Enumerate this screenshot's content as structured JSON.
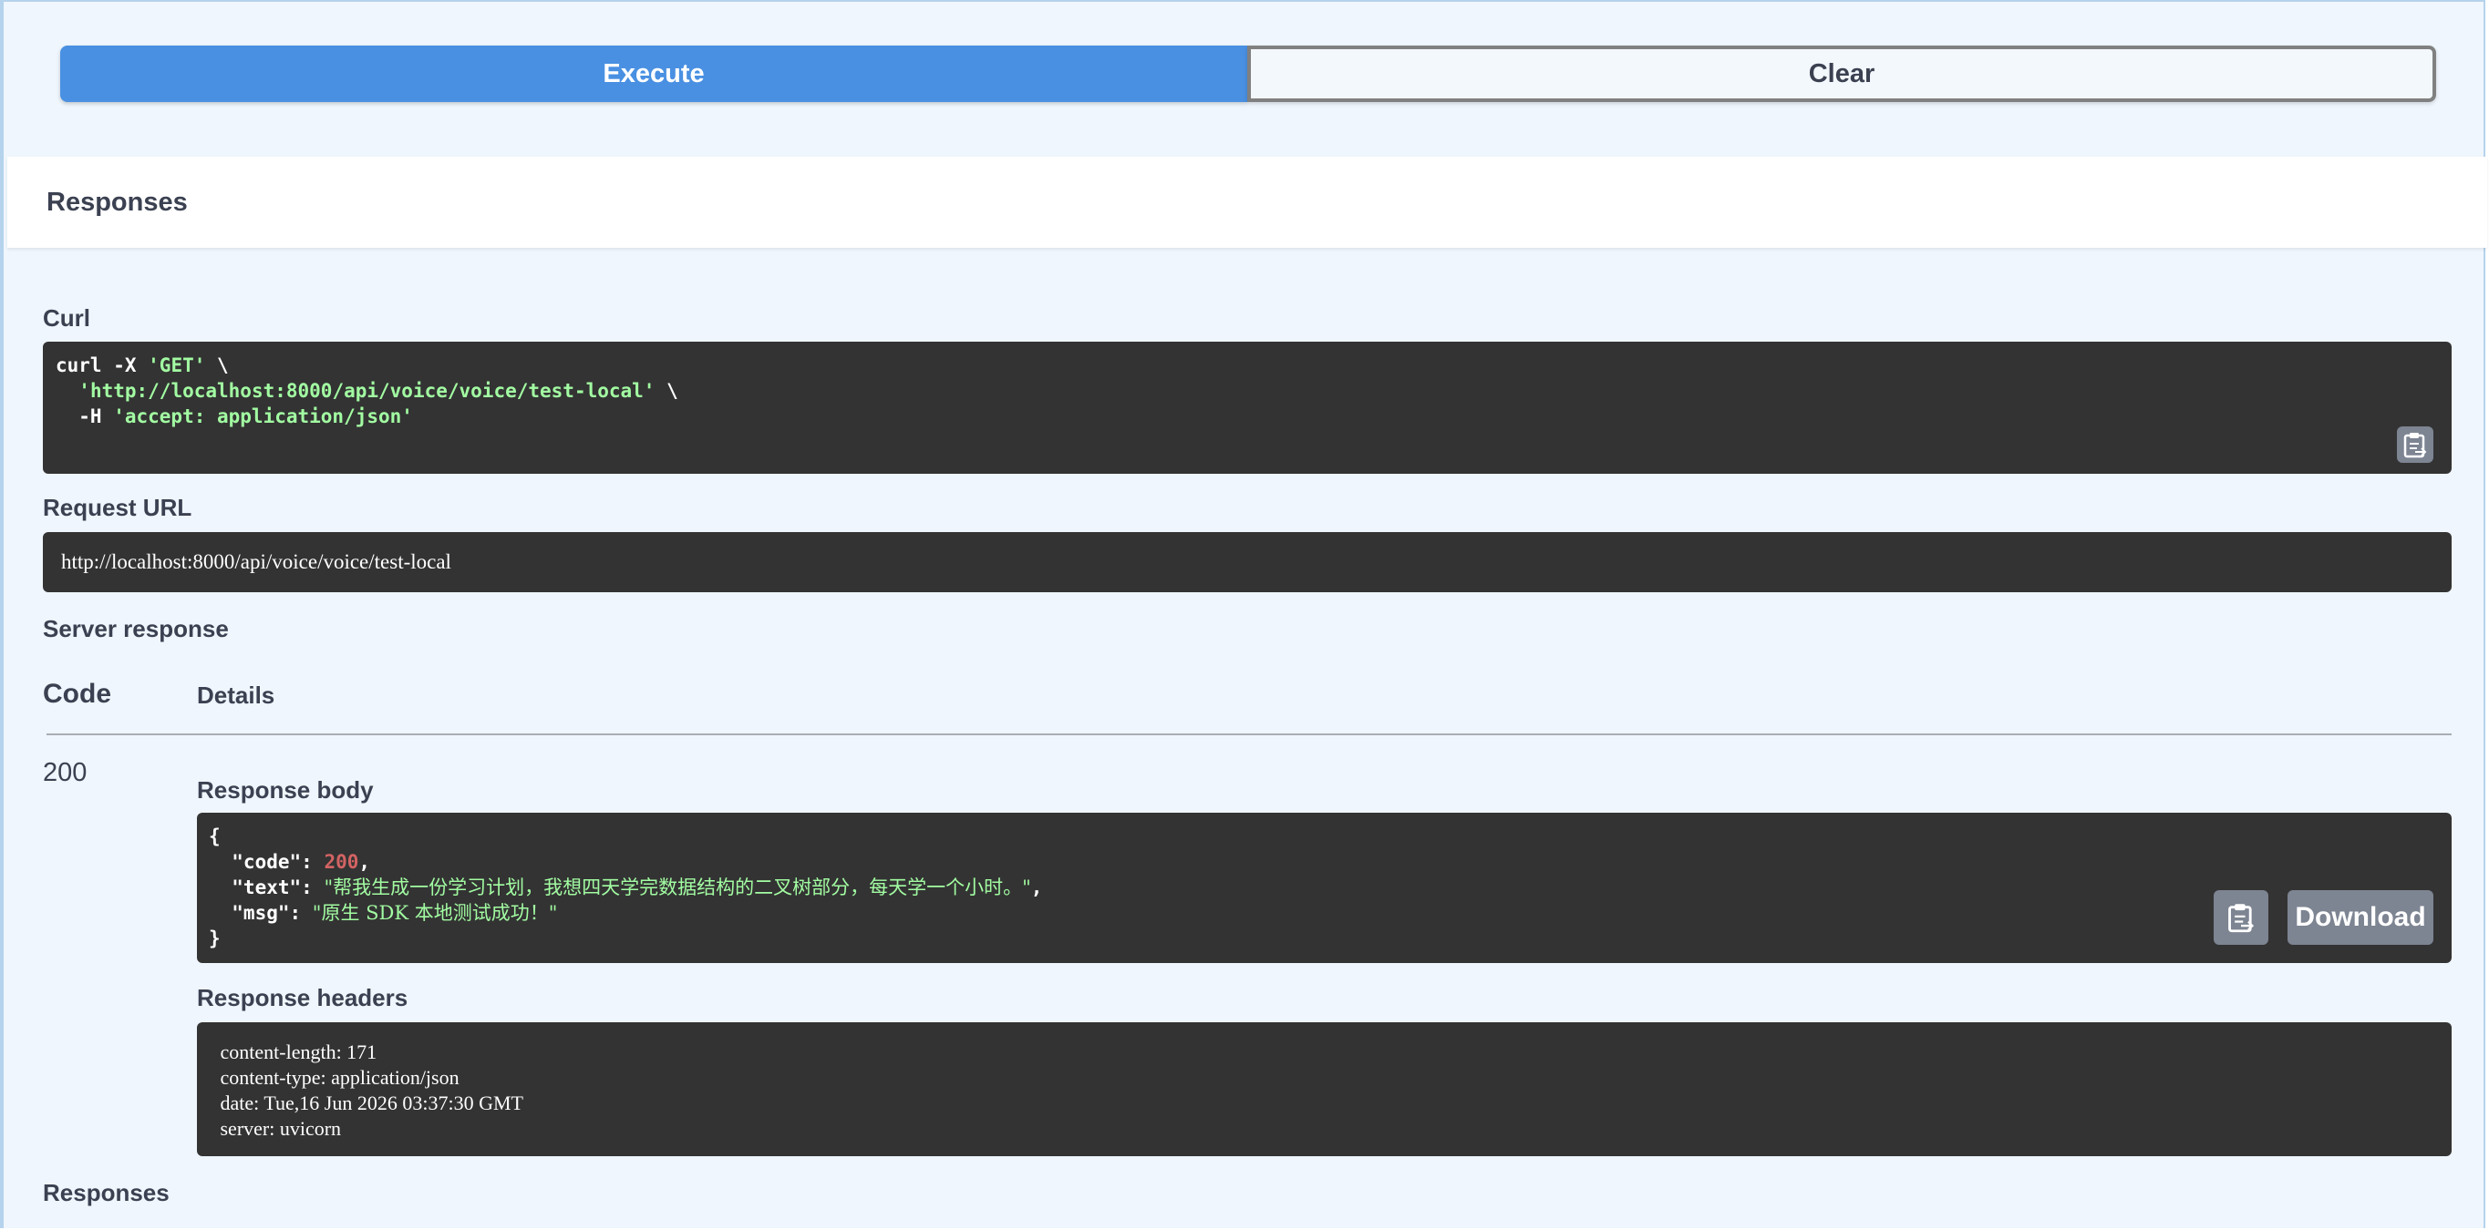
{
  "actions": {
    "execute_label": "Execute",
    "clear_label": "Clear"
  },
  "responses": {
    "title": "Responses",
    "bottom_title": "Responses"
  },
  "curl": {
    "label": "Curl",
    "line1_cmd": "curl -X ",
    "line1_method": "'GET'",
    "line1_tail": " \\",
    "line2_indent": "  ",
    "line2_url": "'http://localhost:8000/api/voice/voice/test-local'",
    "line2_tail": " \\",
    "line3_flag": "  -H ",
    "line3_header": "'accept: application/json'"
  },
  "request_url": {
    "label": "Request URL",
    "value": "http://localhost:8000/api/voice/voice/test-local"
  },
  "server_response": {
    "label": "Server response",
    "col_code": "Code",
    "col_details": "Details",
    "code": "200",
    "body_label": "Response body",
    "body": {
      "open": "{",
      "code_key": "  \"code\": ",
      "code_val": "200",
      "code_comma": ",",
      "text_key": "  \"text\": ",
      "text_val": "\"帮我生成一份学习计划，我想四天学完数据结构的二叉树部分，每天学一个小时。\"",
      "text_comma": ",",
      "msg_key": "  \"msg\": ",
      "msg_val": "\"原生 SDK 本地测试成功！\"",
      "close": "}"
    },
    "download_label": "Download",
    "headers_label": "Response headers",
    "headers": [
      " content-length: 171 ",
      " content-type: application/json ",
      " date: Tue,16 Jun 2026 03:37:30 GMT ",
      " server: uvicorn "
    ]
  },
  "icons": {
    "copy": "clipboard-copy-icon"
  }
}
